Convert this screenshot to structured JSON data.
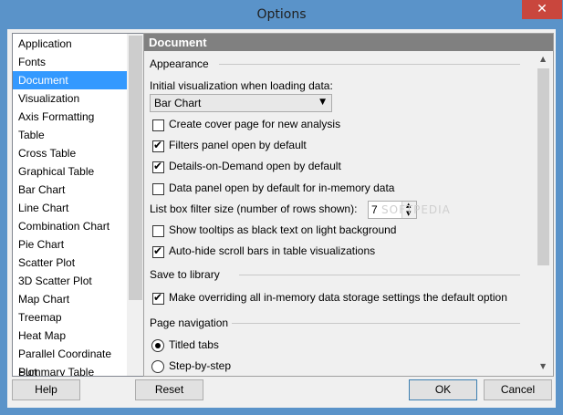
{
  "window": {
    "title": "Options",
    "close_label": "✕"
  },
  "nav": {
    "items": [
      {
        "label": "Application"
      },
      {
        "label": "Fonts"
      },
      {
        "label": "Document"
      },
      {
        "label": "Visualization"
      },
      {
        "label": "Axis Formatting"
      },
      {
        "label": "Table"
      },
      {
        "label": "Cross Table"
      },
      {
        "label": "Graphical Table"
      },
      {
        "label": "Bar Chart"
      },
      {
        "label": "Line Chart"
      },
      {
        "label": "Combination Chart"
      },
      {
        "label": "Pie Chart"
      },
      {
        "label": "Scatter Plot"
      },
      {
        "label": "3D Scatter Plot"
      },
      {
        "label": "Map Chart"
      },
      {
        "label": "Treemap"
      },
      {
        "label": "Heat Map"
      },
      {
        "label": "Parallel Coordinate Plot"
      },
      {
        "label": "Summary Table"
      }
    ],
    "selected": "Document"
  },
  "panel": {
    "header": "Document",
    "appearance": {
      "group_label": "Appearance",
      "initial_viz_label": "Initial visualization when loading data:",
      "initial_viz_value": "Bar Chart",
      "checks": [
        {
          "label": "Create cover page for new analysis",
          "checked": false
        },
        {
          "label": "Filters panel open by default",
          "checked": true
        },
        {
          "label": "Details-on-Demand open by default",
          "checked": true
        },
        {
          "label": "Data panel open by default for in-memory data",
          "checked": false
        }
      ],
      "listbox_label": "List box filter size (number of rows shown):",
      "listbox_value": "7",
      "checks2": [
        {
          "label": "Show tooltips as black text on light background",
          "checked": false
        },
        {
          "label": "Auto-hide scroll bars in table visualizations",
          "checked": true
        }
      ]
    },
    "save": {
      "group_label": "Save to library",
      "check": {
        "label": "Make overriding all in-memory data storage settings the default option",
        "checked": true
      }
    },
    "navigation": {
      "group_label": "Page navigation",
      "options": [
        {
          "label": "Titled tabs",
          "selected": true
        },
        {
          "label": "Step-by-step",
          "selected": false
        }
      ]
    }
  },
  "buttons": {
    "help": "Help",
    "reset": "Reset",
    "ok": "OK",
    "cancel": "Cancel"
  },
  "watermark": "SOFTPEDIA"
}
